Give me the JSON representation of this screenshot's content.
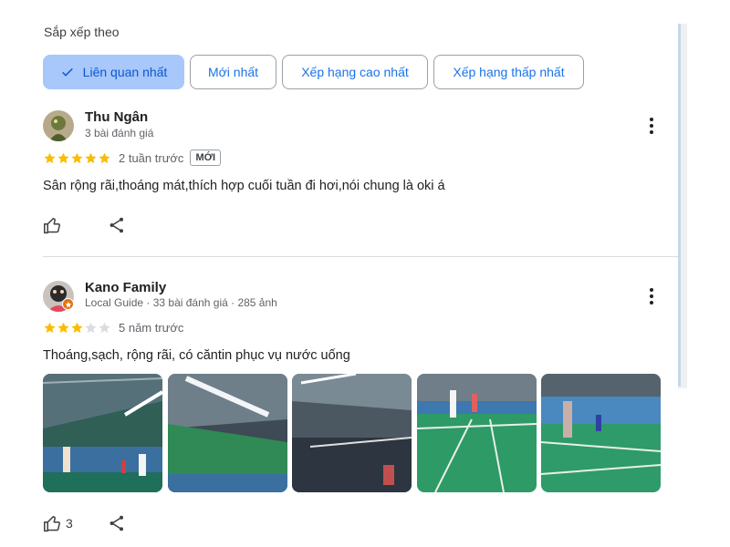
{
  "sort": {
    "label": "Sắp xếp theo",
    "options": [
      {
        "label": "Liên quan nhất",
        "selected": true
      },
      {
        "label": "Mới nhất",
        "selected": false
      },
      {
        "label": "Xếp hạng cao nhất",
        "selected": false
      },
      {
        "label": "Xếp hạng thấp nhất",
        "selected": false
      }
    ]
  },
  "reviews": [
    {
      "name": "Thu Ngân",
      "meta": "3 bài đánh giá",
      "rating": 5,
      "time": "2 tuần trước",
      "badge": "MỚI",
      "text": "Sân rộng rãi,thoáng mát,thích hợp cuối tuần đi hơi,nói chung là oki á",
      "likes": ""
    },
    {
      "name": "Kano Family",
      "meta": "Local Guide · 33 bài đánh giá · 285 ảnh",
      "rating": 3,
      "time": "5 năm trước",
      "text": "Thoáng,sạch, rộng rãi, có căntin phục vụ nước uống",
      "likes": "3",
      "photo_count": 5
    }
  ],
  "icons": {
    "check": "check-icon",
    "star": "star-icon",
    "like": "thumb-up-icon",
    "share": "share-icon",
    "more": "more-vert-icon"
  },
  "colors": {
    "star_filled": "#fbbc04",
    "star_empty": "#dadce0",
    "chip_selected_bg": "#a8c7fa",
    "accent": "#1a73e8"
  }
}
